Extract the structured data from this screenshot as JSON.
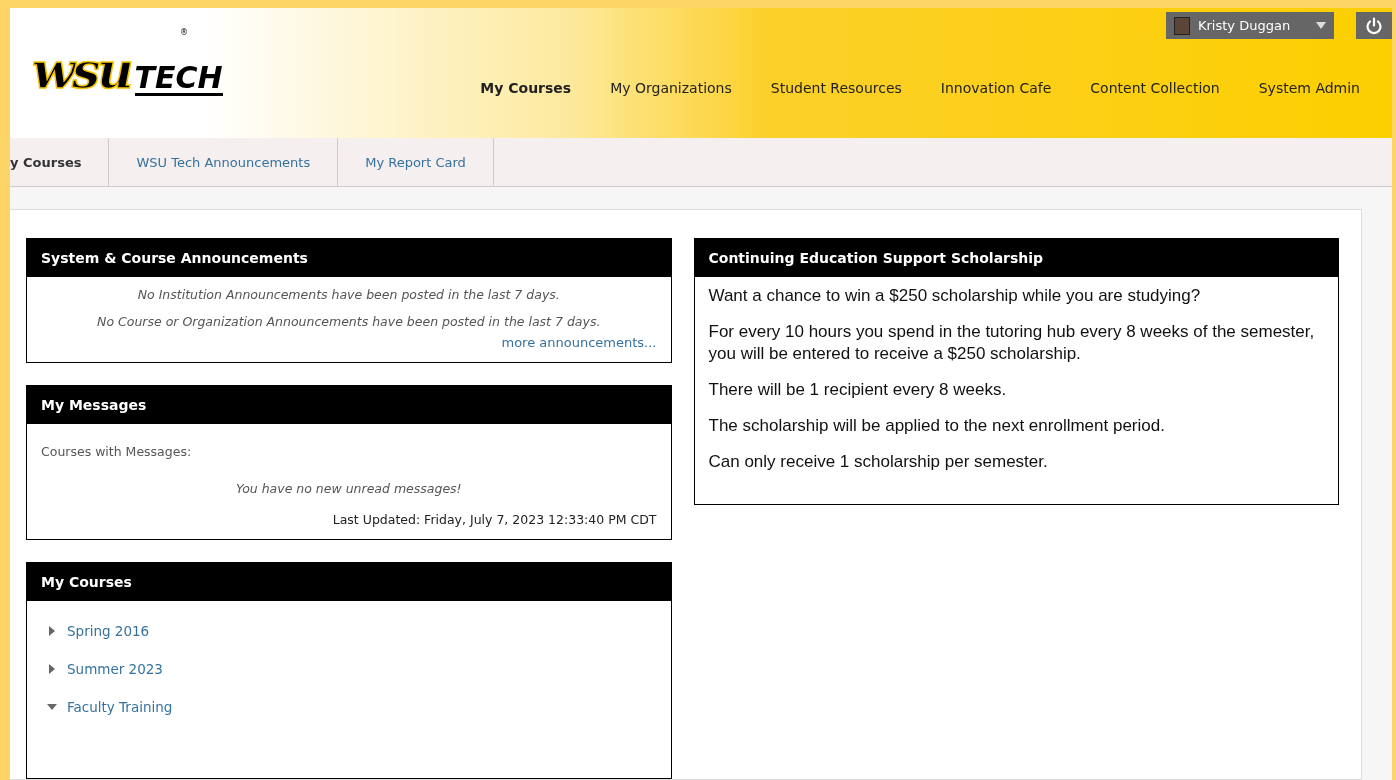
{
  "logo": {
    "mark": "wsu",
    "word": "TECH",
    "registered": "®"
  },
  "user_menu": {
    "name": "Kristy Duggan"
  },
  "nav": [
    {
      "label": "My Courses",
      "selected": true
    },
    {
      "label": "My Organizations",
      "selected": false
    },
    {
      "label": "Student Resources",
      "selected": false
    },
    {
      "label": "Innovation Cafe",
      "selected": false
    },
    {
      "label": "Content Collection",
      "selected": false
    },
    {
      "label": "System Admin",
      "selected": false
    }
  ],
  "tabs": [
    {
      "label": "y Courses",
      "selected": true
    },
    {
      "label": "WSU Tech Announcements",
      "selected": false
    },
    {
      "label": "My Report Card",
      "selected": false
    }
  ],
  "announcements": {
    "title": "System & Course Announcements",
    "lines": [
      "No Institution Announcements have been posted in the last 7 days.",
      "No Course or Organization Announcements have been posted in the last 7 days."
    ],
    "link": "more announcements..."
  },
  "messages": {
    "title": "My Messages",
    "label": "Courses with Messages:",
    "empty": "You have no new unread messages!",
    "updated": "Last Updated: Friday, July 7, 2023 12:33:40 PM CDT"
  },
  "courses": {
    "title": "My Courses",
    "items": [
      {
        "label": "Spring 2016",
        "expanded": false
      },
      {
        "label": "Summer 2023",
        "expanded": false
      },
      {
        "label": "Faculty Training",
        "expanded": true
      }
    ]
  },
  "scholarship": {
    "title": "Continuing Education Support Scholarship",
    "paragraphs": [
      "Want a chance to win a $250 scholarship while you are studying?",
      "For every 10 hours you spend in the tutoring hub every 8 weeks of the semester, you will be entered to receive a $250 scholarship.",
      "There will be 1 recipient every 8 weeks.",
      "The scholarship will be applied to the next enrollment period.",
      "Can only receive 1 scholarship per semester."
    ]
  }
}
